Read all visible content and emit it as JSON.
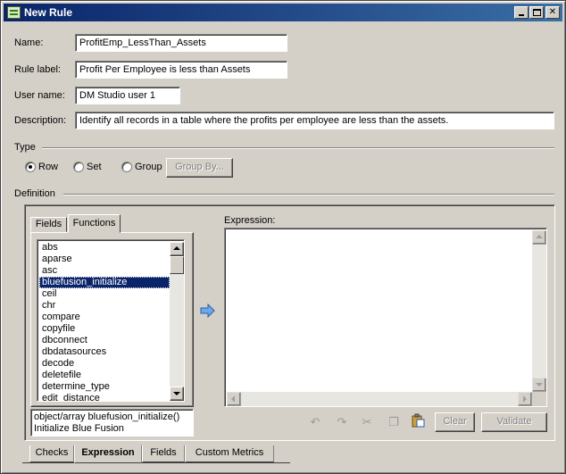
{
  "window": {
    "title": "New Rule"
  },
  "form": {
    "name_label": "Name:",
    "name_value": "ProfitEmp_LessThan_Assets",
    "rule_label_label": "Rule label:",
    "rule_label_value": "Profit Per Employee is less than Assets",
    "user_name_label": "User name:",
    "user_name_value": "DM Studio user 1",
    "description_label": "Description:",
    "description_value": "Identify all records in a table where the profits per employee are less than the assets."
  },
  "type_group": {
    "label": "Type",
    "row_label": "Row",
    "set_label": "Set",
    "group_label": "Group",
    "group_by_button": "Group By..."
  },
  "definition": {
    "label": "Definition",
    "tab_fields": "Fields",
    "tab_functions": "Functions",
    "functions": [
      "abs",
      "aparse",
      "asc",
      "bluefusion_initialize",
      "ceil",
      "chr",
      "compare",
      "copyfile",
      "dbconnect",
      "dbdatasources",
      "decode",
      "deletefile",
      "determine_type",
      "edit_distance"
    ],
    "selected_function": "bluefusion_initialize",
    "signature": "object/array bluefusion_initialize()",
    "signature_desc": "Initialize Blue Fusion",
    "expression_label": "Expression:",
    "clear_button": "Clear",
    "validate_button": "Validate"
  },
  "bottom_tabs": [
    "Checks",
    "Expression",
    "Fields",
    "Custom Metrics"
  ],
  "active_bottom_tab": "Expression",
  "colors": {
    "titlebar": "#0a246a",
    "selection": "#0a246a",
    "face": "#d4d0c8"
  }
}
